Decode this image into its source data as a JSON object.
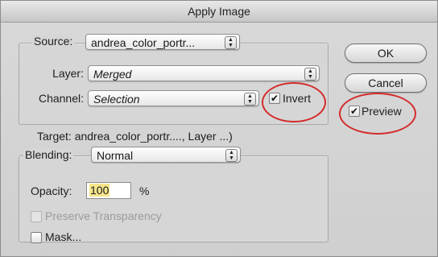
{
  "window": {
    "title": "Apply Image"
  },
  "source": {
    "label": "Source:",
    "value": "andrea_color_portr...",
    "layer_label": "Layer:",
    "layer_value": "Merged",
    "channel_label": "Channel:",
    "channel_value": "Selection",
    "invert_label": "Invert",
    "invert_checked": true
  },
  "target": {
    "text": "Target:  andrea_color_portr...., Layer ...)"
  },
  "blending": {
    "label": "Blending:",
    "value": "Normal",
    "opacity_label": "Opacity:",
    "opacity_value": "100",
    "opacity_unit": "%",
    "preserve_transparency_label": "Preserve Transparency",
    "mask_label": "Mask..."
  },
  "buttons": {
    "ok": "OK",
    "cancel": "Cancel"
  },
  "preview": {
    "label": "Preview",
    "checked": true
  },
  "colors": {
    "annotation_ring": "#d42c2c",
    "highlight": "#f6e58b"
  }
}
